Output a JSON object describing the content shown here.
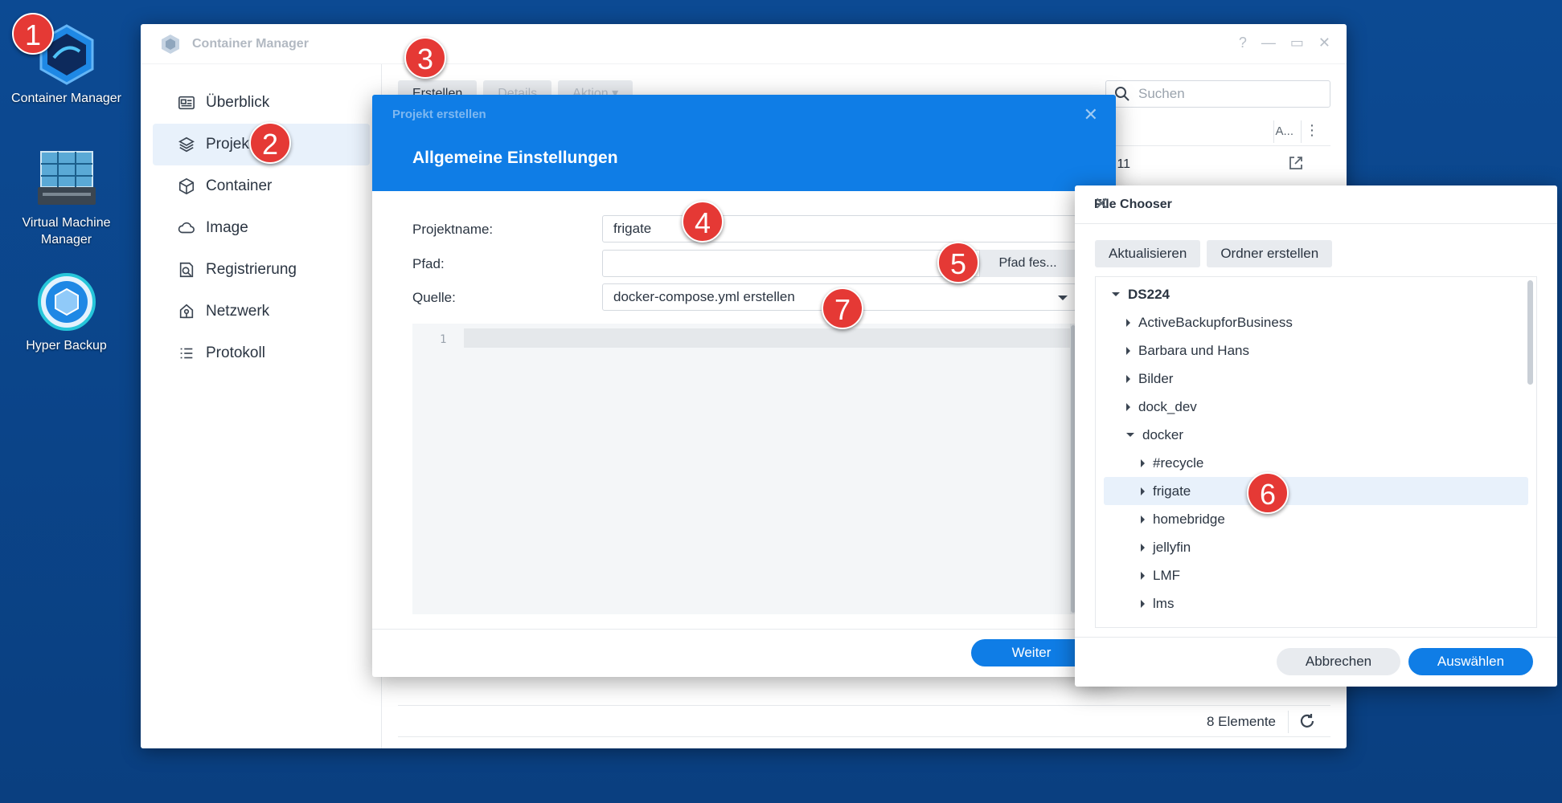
{
  "desktop": {
    "icons": [
      {
        "label": "Container Manager"
      },
      {
        "label": "Virtual Machine Manager"
      },
      {
        "label": "Hyper Backup"
      }
    ]
  },
  "badges": [
    "1",
    "2",
    "3",
    "4",
    "5",
    "6",
    "7"
  ],
  "window": {
    "title": "Container Manager",
    "controls": {
      "help": "?",
      "minimize": "—",
      "maximize": "▭",
      "close": "✕"
    }
  },
  "sidebar": {
    "items": [
      {
        "label": "Überblick",
        "icon": "overview-icon"
      },
      {
        "label": "Projekt",
        "icon": "layers-icon"
      },
      {
        "label": "Container",
        "icon": "cube-icon"
      },
      {
        "label": "Image",
        "icon": "cloud-icon"
      },
      {
        "label": "Registrierung",
        "icon": "registry-icon"
      },
      {
        "label": "Netzwerk",
        "icon": "network-icon"
      },
      {
        "label": "Protokoll",
        "icon": "list-icon"
      }
    ]
  },
  "toolbar": {
    "create": "Erstellen",
    "details": "Details",
    "action": "Aktion ▾"
  },
  "search": {
    "placeholder": "Suchen"
  },
  "table": {
    "col_a": "A...",
    "more": "⋮",
    "row1_text": ":11"
  },
  "footer": {
    "count": "8 Elemente"
  },
  "dialog": {
    "header_small": "Projekt erstellen",
    "header_big": "Allgemeine Einstellungen",
    "close": "✕",
    "fields": {
      "projektname_label": "Projektname:",
      "projektname_value": "frigate",
      "pfad_label": "Pfad:",
      "pfad_value": "",
      "pfad_button": "Pfad fes...",
      "quelle_label": "Quelle:",
      "quelle_value": "docker-compose.yml erstellen"
    },
    "editor": {
      "line_number": "1"
    },
    "next_button": "Weiter"
  },
  "file_chooser": {
    "title": "File Chooser",
    "close": "✕",
    "refresh_button": "Aktualisieren",
    "new_folder_button": "Ordner erstellen",
    "tree": [
      {
        "label": "DS224",
        "level": 0,
        "expanded": true,
        "selected": false
      },
      {
        "label": "ActiveBackupforBusiness",
        "level": 1,
        "expanded": false,
        "selected": false
      },
      {
        "label": "Barbara und Hans",
        "level": 1,
        "expanded": false,
        "selected": false
      },
      {
        "label": "Bilder",
        "level": 1,
        "expanded": false,
        "selected": false
      },
      {
        "label": "dock_dev",
        "level": 1,
        "expanded": false,
        "selected": false
      },
      {
        "label": "docker",
        "level": 1,
        "expanded": true,
        "selected": false
      },
      {
        "label": "#recycle",
        "level": 2,
        "expanded": false,
        "selected": false
      },
      {
        "label": "frigate",
        "level": 2,
        "expanded": false,
        "selected": true
      },
      {
        "label": "homebridge",
        "level": 2,
        "expanded": false,
        "selected": false
      },
      {
        "label": "jellyfin",
        "level": 2,
        "expanded": false,
        "selected": false
      },
      {
        "label": "LMF",
        "level": 2,
        "expanded": false,
        "selected": false
      },
      {
        "label": "lms",
        "level": 2,
        "expanded": false,
        "selected": false
      }
    ],
    "cancel_button": "Abbrechen",
    "select_button": "Auswählen"
  },
  "colors": {
    "accent": "#0f7de6",
    "badge": "#e53935",
    "desktop": "#0b4489"
  }
}
